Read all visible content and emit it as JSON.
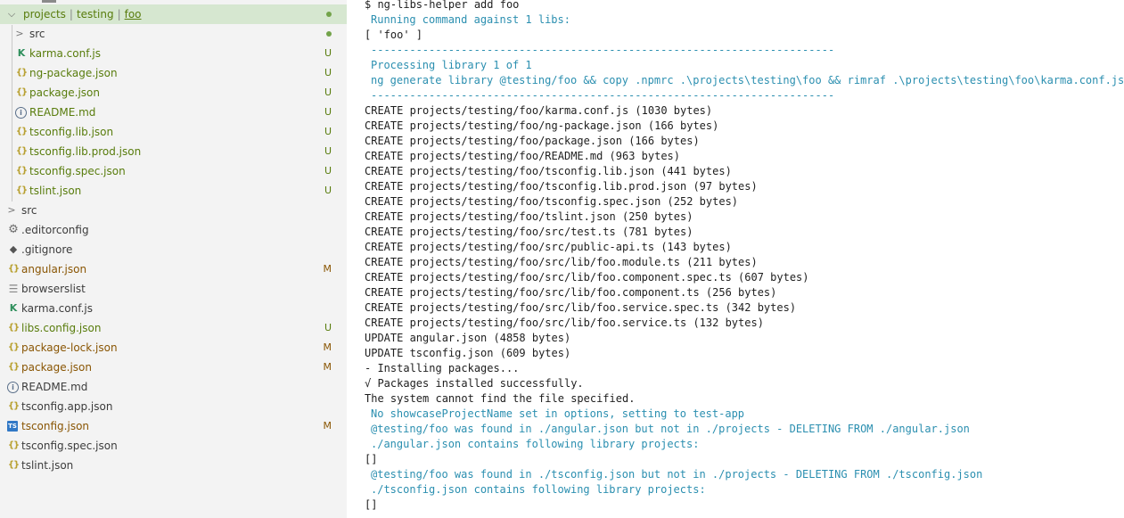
{
  "explorer": {
    "breadcrumb": {
      "segments": [
        "projects",
        "testing",
        "foo"
      ]
    },
    "rows": [
      {
        "label": "src",
        "indent": 2,
        "chevron": ">",
        "icon": "",
        "color": "plain",
        "dot": true
      },
      {
        "label": "karma.conf.js",
        "indent": 2,
        "icon": "karma",
        "color": "green",
        "badge": "U"
      },
      {
        "label": "ng-package.json",
        "indent": 2,
        "icon": "json",
        "color": "green",
        "badge": "U"
      },
      {
        "label": "package.json",
        "indent": 2,
        "icon": "json",
        "color": "green",
        "badge": "U"
      },
      {
        "label": "README.md",
        "indent": 2,
        "icon": "info",
        "color": "green",
        "badge": "U"
      },
      {
        "label": "tsconfig.lib.json",
        "indent": 2,
        "icon": "json",
        "color": "green",
        "badge": "U"
      },
      {
        "label": "tsconfig.lib.prod.json",
        "indent": 2,
        "icon": "json",
        "color": "green",
        "badge": "U"
      },
      {
        "label": "tsconfig.spec.json",
        "indent": 2,
        "icon": "json",
        "color": "green",
        "badge": "U"
      },
      {
        "label": "tslint.json",
        "indent": 2,
        "icon": "json",
        "color": "green",
        "badge": "U"
      },
      {
        "label": "src",
        "indent": 0,
        "chevron": ">",
        "icon": "",
        "color": "plain"
      },
      {
        "label": ".editorconfig",
        "indent": 1,
        "icon": "gear",
        "color": "plain"
      },
      {
        "label": ".gitignore",
        "indent": 1,
        "icon": "git",
        "color": "plain"
      },
      {
        "label": "angular.json",
        "indent": 1,
        "icon": "json",
        "color": "brown",
        "badge": "M"
      },
      {
        "label": "browserslist",
        "indent": 1,
        "icon": "lines",
        "color": "plain"
      },
      {
        "label": "karma.conf.js",
        "indent": 1,
        "icon": "karma",
        "color": "plain"
      },
      {
        "label": "libs.config.json",
        "indent": 1,
        "icon": "json",
        "color": "green",
        "badge": "U"
      },
      {
        "label": "package-lock.json",
        "indent": 1,
        "icon": "json",
        "color": "brown",
        "badge": "M"
      },
      {
        "label": "package.json",
        "indent": 1,
        "icon": "json",
        "color": "brown",
        "badge": "M"
      },
      {
        "label": "README.md",
        "indent": 1,
        "icon": "info",
        "color": "plain"
      },
      {
        "label": "tsconfig.app.json",
        "indent": 1,
        "icon": "json",
        "color": "plain"
      },
      {
        "label": "tsconfig.json",
        "indent": 1,
        "icon": "ts",
        "color": "brown",
        "badge": "M"
      },
      {
        "label": "tsconfig.spec.json",
        "indent": 1,
        "icon": "json",
        "color": "plain"
      },
      {
        "label": "tslint.json",
        "indent": 1,
        "icon": "json",
        "color": "plain"
      }
    ]
  },
  "icons": {
    "json": "{}",
    "karma": "K",
    "info": "i",
    "gear": "⚙",
    "git": "◆",
    "lines": "☰",
    "ts": "TS"
  },
  "colors": {
    "explorer_bg": "#f3f3f3",
    "selected_row": "#d6e7d0",
    "untracked": "#587c0c",
    "modified": "#895503",
    "terminal_info": "#2b8fb0"
  },
  "terminal": {
    "lines": [
      {
        "text": "$ ng-libs-helper add foo",
        "style": "plain"
      },
      {
        "text": "Running command against 1 libs:",
        "style": "cyan"
      },
      {
        "text": "[ 'foo' ]",
        "style": "plain"
      },
      {
        "text": "------------------------------------------------------------------------",
        "style": "cyan"
      },
      {
        "text": "Processing library 1 of 1",
        "style": "cyan"
      },
      {
        "text": "ng generate library @testing/foo && copy .npmrc .\\projects\\testing\\foo && rimraf .\\projects\\testing\\foo\\karma.conf.js",
        "style": "cyan"
      },
      {
        "text": "------------------------------------------------------------------------",
        "style": "cyan"
      },
      {
        "text": "CREATE projects/testing/foo/karma.conf.js (1030 bytes)",
        "style": "plain"
      },
      {
        "text": "CREATE projects/testing/foo/ng-package.json (166 bytes)",
        "style": "plain"
      },
      {
        "text": "CREATE projects/testing/foo/package.json (166 bytes)",
        "style": "plain"
      },
      {
        "text": "CREATE projects/testing/foo/README.md (963 bytes)",
        "style": "plain"
      },
      {
        "text": "CREATE projects/testing/foo/tsconfig.lib.json (441 bytes)",
        "style": "plain"
      },
      {
        "text": "CREATE projects/testing/foo/tsconfig.lib.prod.json (97 bytes)",
        "style": "plain"
      },
      {
        "text": "CREATE projects/testing/foo/tsconfig.spec.json (252 bytes)",
        "style": "plain"
      },
      {
        "text": "CREATE projects/testing/foo/tslint.json (250 bytes)",
        "style": "plain"
      },
      {
        "text": "CREATE projects/testing/foo/src/test.ts (781 bytes)",
        "style": "plain"
      },
      {
        "text": "CREATE projects/testing/foo/src/public-api.ts (143 bytes)",
        "style": "plain"
      },
      {
        "text": "CREATE projects/testing/foo/src/lib/foo.module.ts (211 bytes)",
        "style": "plain"
      },
      {
        "text": "CREATE projects/testing/foo/src/lib/foo.component.spec.ts (607 bytes)",
        "style": "plain"
      },
      {
        "text": "CREATE projects/testing/foo/src/lib/foo.component.ts (256 bytes)",
        "style": "plain"
      },
      {
        "text": "CREATE projects/testing/foo/src/lib/foo.service.spec.ts (342 bytes)",
        "style": "plain"
      },
      {
        "text": "CREATE projects/testing/foo/src/lib/foo.service.ts (132 bytes)",
        "style": "plain"
      },
      {
        "text": "UPDATE angular.json (4858 bytes)",
        "style": "plain"
      },
      {
        "text": "UPDATE tsconfig.json (609 bytes)",
        "style": "plain"
      },
      {
        "text": "- Installing packages...",
        "style": "plain"
      },
      {
        "text": "√ Packages installed successfully.",
        "style": "plain"
      },
      {
        "text": "The system cannot find the file specified.",
        "style": "plain"
      },
      {
        "text": "No showcaseProjectName set in options, setting to test-app",
        "style": "cyan"
      },
      {
        "text": "@testing/foo was found in ./angular.json but not in ./projects - DELETING FROM ./angular.json",
        "style": "cyan"
      },
      {
        "text": "./angular.json contains following library projects:",
        "style": "cyan"
      },
      {
        "text": "[]",
        "style": "plain"
      },
      {
        "text": "@testing/foo was found in ./tsconfig.json but not in ./projects - DELETING FROM ./tsconfig.json",
        "style": "cyan"
      },
      {
        "text": "./tsconfig.json contains following library projects:",
        "style": "cyan"
      },
      {
        "text": "[]",
        "style": "plain"
      }
    ]
  }
}
